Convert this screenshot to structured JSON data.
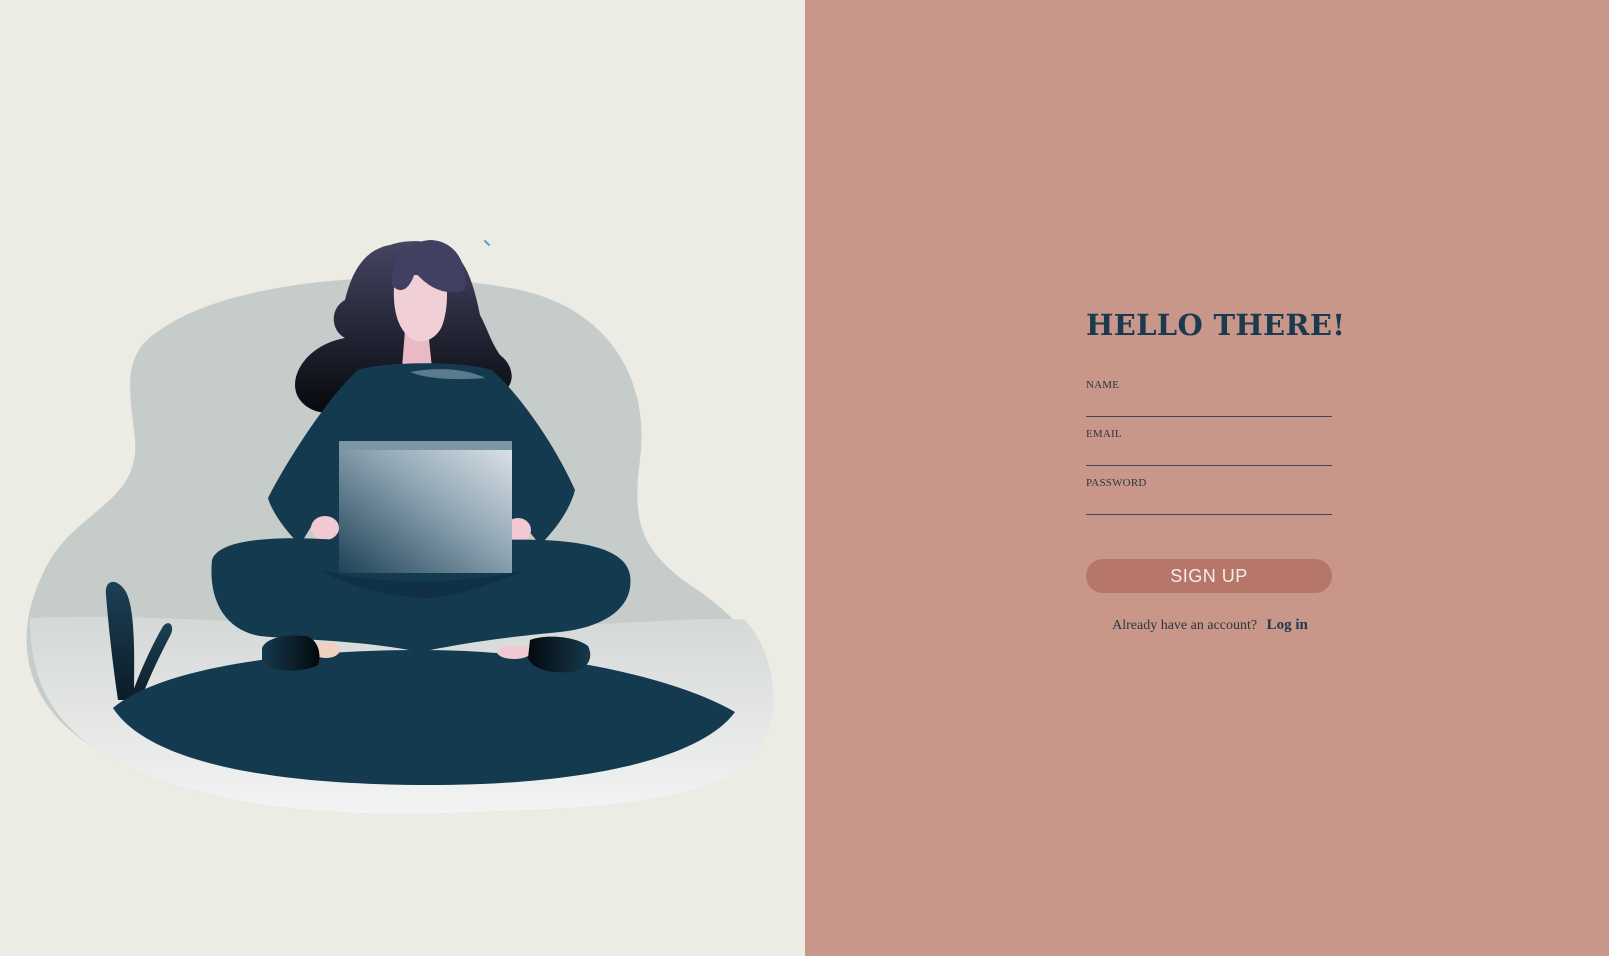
{
  "signup": {
    "title": "HELLO THERE!",
    "fields": [
      {
        "label": "NAME",
        "value": "",
        "placeholder": ""
      },
      {
        "label": "EMAIL",
        "value": "",
        "placeholder": ""
      },
      {
        "label": "PASSWORD",
        "value": "",
        "placeholder": ""
      }
    ],
    "submit_label": "SIGN UP",
    "login_prompt": "Already have an account?",
    "login_link": "Log in"
  },
  "colors": {
    "left_background": "#ecebe4",
    "right_background": "#c99789",
    "accent": "#b7766a",
    "heading": "#1b3a4f"
  },
  "illustration": {
    "subject": "woman-sitting-cross-legged-with-laptop"
  }
}
